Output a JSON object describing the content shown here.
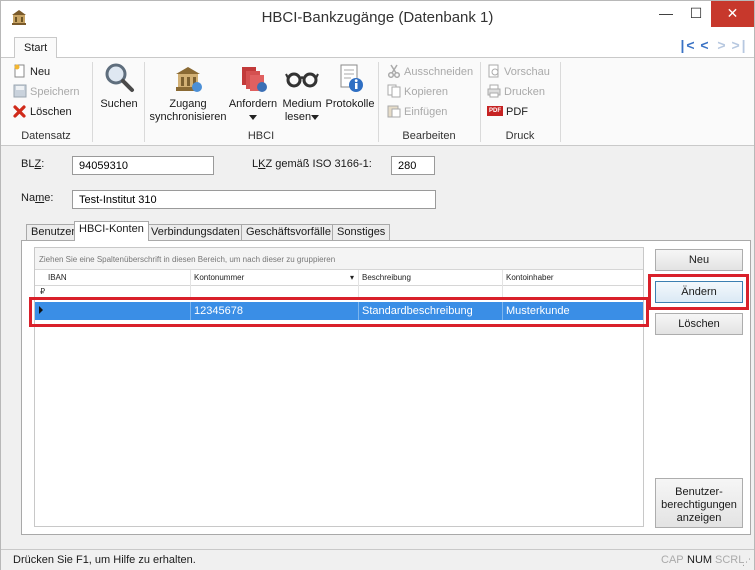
{
  "window": {
    "title": "HBCI-Bankzugänge (Datenbank 1)",
    "minimize_glyph": "—",
    "maximize_glyph": "☐",
    "close_glyph": "✕"
  },
  "ribbon": {
    "tab_label": "Start",
    "nav": {
      "first": "|<",
      "prev": "<",
      "next": ">",
      "last": ">|"
    },
    "groups": {
      "datensatz": {
        "label": "Datensatz",
        "neu": "Neu",
        "speichern": "Speichern",
        "loeschen": "Löschen"
      },
      "suchen": {
        "label": "Suchen"
      },
      "hbci": {
        "label": "HBCI",
        "zugang_line1": "Zugang",
        "zugang_line2": "synchronisieren",
        "anfordern": "Anfordern",
        "medium_line1": "Medium",
        "medium_line2": "lesen",
        "protokolle": "Protokolle"
      },
      "bearbeiten": {
        "label": "Bearbeiten",
        "ausschneiden": "Ausschneiden",
        "kopieren": "Kopieren",
        "einfuegen": "Einfügen"
      },
      "druck": {
        "label": "Druck",
        "vorschau": "Vorschau",
        "drucken": "Drucken",
        "pdf": "PDF",
        "pdf_badge": "PDF"
      }
    }
  },
  "form": {
    "blz_label_pre": "BL",
    "blz_label_u": "Z",
    "blz_label_post": ":",
    "blz_value": "94059310",
    "lkz_label_pre": "L",
    "lkz_label_u": "K",
    "lkz_label_post": "Z gemäß ISO 3166-1:",
    "lkz_value": "280",
    "name_label_pre": "Na",
    "name_label_u": "m",
    "name_label_post": "e:",
    "name_value": "Test-Institut 310"
  },
  "tabs": [
    {
      "label": "Benutzer"
    },
    {
      "label": "HBCI-Konten"
    },
    {
      "label": "Verbindungsdaten"
    },
    {
      "label": "Geschäftsvorfälle"
    },
    {
      "label": "Sonstiges"
    }
  ],
  "grid": {
    "group_hint": "Ziehen Sie eine Spaltenüberschrift in diesen Bereich, um nach dieser zu gruppieren",
    "filter_pin": "₽",
    "columns": [
      "IBAN",
      "Kontonummer",
      "Beschreibung",
      "Kontoinhaber"
    ],
    "sort_indicator": "▾",
    "rows": [
      {
        "iban": "",
        "kontonummer": "12345678",
        "beschreibung": "Standardbeschreibung",
        "kontoinhaber": "Musterkunde"
      }
    ]
  },
  "buttons": {
    "neu": "Neu",
    "aendern": "Ändern",
    "loeschen": "Löschen",
    "benutzer_line1": "Benutzer-",
    "benutzer_line2": "berechtigungen",
    "benutzer_line3": "anzeigen"
  },
  "status": {
    "text": "Drücken Sie F1, um Hilfe zu erhalten.",
    "cap": "CAP",
    "num": "NUM",
    "scrl": "SCRL"
  },
  "colors": {
    "selection": "#3a8ee6",
    "highlight": "#d9202a",
    "close_button": "#c7382c"
  }
}
